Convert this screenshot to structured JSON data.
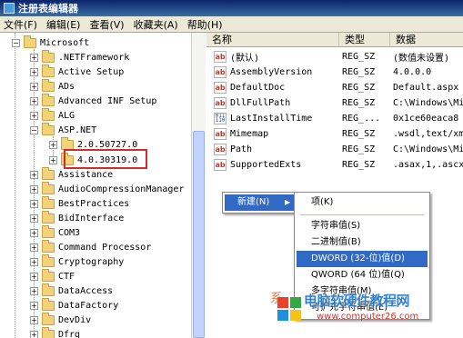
{
  "window": {
    "title": "注册表编辑器"
  },
  "menubar": [
    "文件(F)",
    "编辑(E)",
    "查看(V)",
    "收藏夹(A)",
    "帮助(H)"
  ],
  "tree": {
    "items": [
      {
        "label": "Microsoft",
        "expander": "−"
      },
      {
        "label": ".NETFramework",
        "expander": "+"
      },
      {
        "label": "Active Setup",
        "expander": "+"
      },
      {
        "label": "ADs",
        "expander": "+"
      },
      {
        "label": "Advanced INF Setup",
        "expander": "+"
      },
      {
        "label": "ALG",
        "expander": "+"
      },
      {
        "label": "ASP.NET",
        "expander": "−"
      },
      {
        "label": "2.0.50727.0",
        "expander": "+"
      },
      {
        "label": "4.0.30319.0",
        "expander": "+"
      },
      {
        "label": "Assistance",
        "expander": "+"
      },
      {
        "label": "AudioCompressionManager",
        "expander": "+"
      },
      {
        "label": "BestPractices",
        "expander": "+"
      },
      {
        "label": "BidInterface",
        "expander": "+"
      },
      {
        "label": "COM3",
        "expander": "+"
      },
      {
        "label": "Command Processor",
        "expander": "+"
      },
      {
        "label": "Cryptography",
        "expander": "+"
      },
      {
        "label": "CTF",
        "expander": "+"
      },
      {
        "label": "DataAccess",
        "expander": "+"
      },
      {
        "label": "DataFactory",
        "expander": "+"
      },
      {
        "label": "DevDiv",
        "expander": "+"
      },
      {
        "label": "Dfrg",
        "expander": "+"
      }
    ]
  },
  "list": {
    "columns": [
      "名称",
      "类型",
      "数据"
    ],
    "rows": [
      {
        "name": "(默认)",
        "type": "REG_SZ",
        "data": "(数值未设置)",
        "icon": "ab"
      },
      {
        "name": "AssemblyVersion",
        "type": "REG_SZ",
        "data": "4.0.0.0",
        "icon": "ab"
      },
      {
        "name": "DefaultDoc",
        "type": "REG_SZ",
        "data": "Default.aspx",
        "icon": "ab"
      },
      {
        "name": "DllFullPath",
        "type": "REG_SZ",
        "data": "C:\\Windows\\Mi",
        "icon": "ab"
      },
      {
        "name": "LastInstallTime",
        "type": "REG_...",
        "data": "0x1ce60eaca8",
        "icon": "bin"
      },
      {
        "name": "Mimemap",
        "type": "REG_SZ",
        "data": ".wsdl,text/xm",
        "icon": "ab"
      },
      {
        "name": "Path",
        "type": "REG_SZ",
        "data": "C:\\Windows\\Mi",
        "icon": "ab"
      },
      {
        "name": "SupportedExts",
        "type": "REG_SZ",
        "data": ".asax,1,.ascx",
        "icon": "ab"
      }
    ]
  },
  "context_menu": {
    "new_label": "新建(N)",
    "arrow": "▶"
  },
  "submenu": {
    "items": [
      "项(K)",
      "字符串值(S)",
      "二进制值(B)",
      "DWORD (32-位)值(D)",
      "QWORD (64 位)值(Q)",
      "多字符串值(M)",
      "可扩充字符串值(E)"
    ]
  },
  "watermark": {
    "text": "电脑软硬件教程网",
    "url": "www.computer26.com",
    "side_char": "系"
  },
  "colors": {
    "selection": "#316ac5",
    "highlight_box": "#d62b2b",
    "watermark_blue": "#1e74c8",
    "watermark_red": "#d9342b"
  }
}
